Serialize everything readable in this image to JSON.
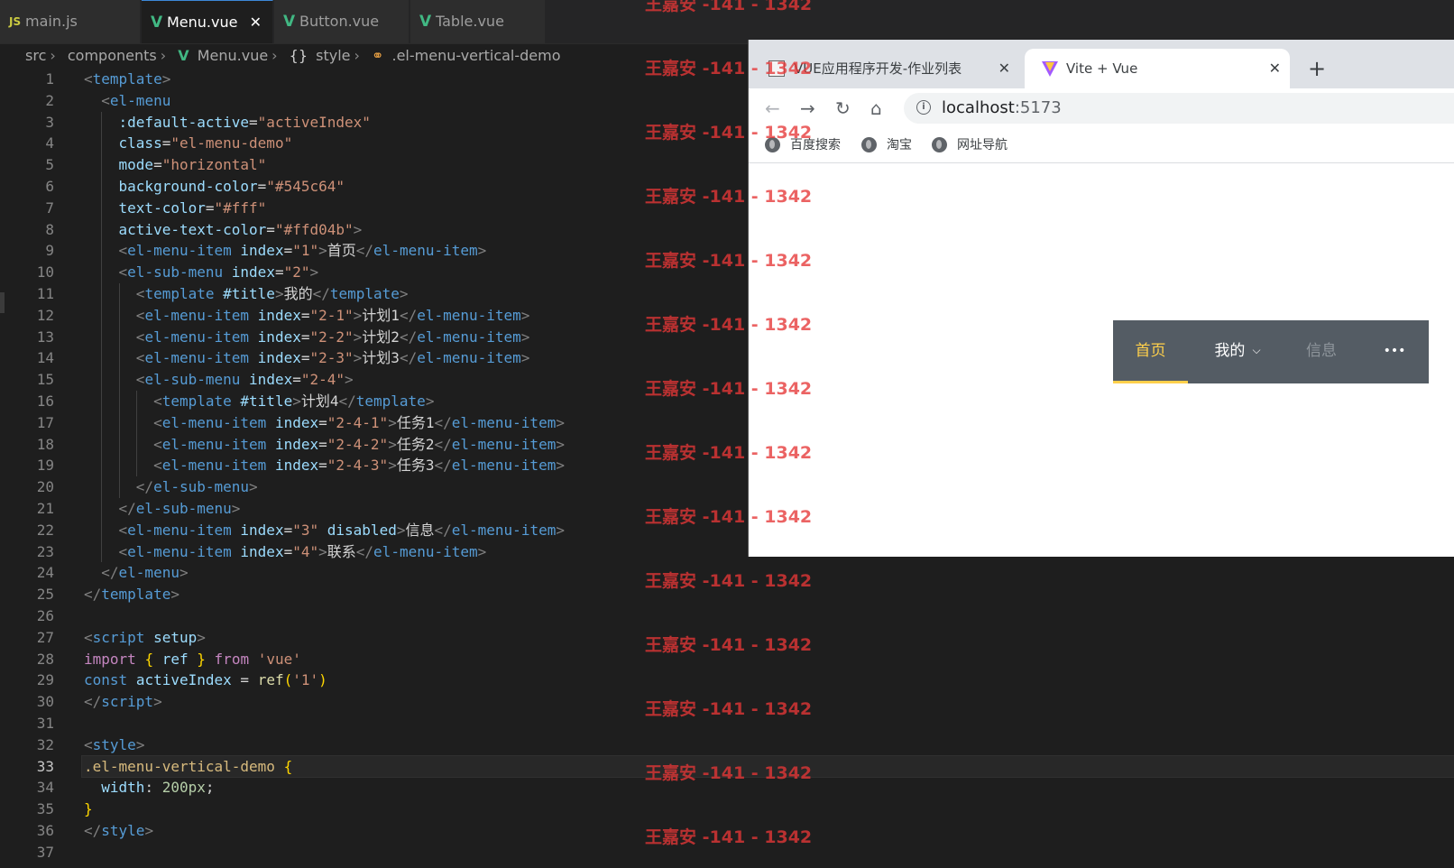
{
  "editor": {
    "tabs": [
      {
        "icon": "JS",
        "label": "main.js",
        "active": false
      },
      {
        "icon": "V",
        "label": "Menu.vue",
        "active": true,
        "close": "✕"
      },
      {
        "icon": "V",
        "label": "Button.vue",
        "active": false
      },
      {
        "icon": "V",
        "label": "Table.vue",
        "active": false
      }
    ],
    "breadcrumb": [
      "src",
      "components",
      "Menu.vue",
      "style",
      ".el-menu-vertical-demo"
    ],
    "current_line": 33,
    "line_numbers": [
      "1",
      "2",
      "3",
      "4",
      "5",
      "6",
      "7",
      "8",
      "9",
      "10",
      "11",
      "12",
      "13",
      "14",
      "15",
      "16",
      "17",
      "18",
      "19",
      "20",
      "21",
      "22",
      "23",
      "24",
      "25",
      "26",
      "27",
      "28",
      "29",
      "30",
      "31",
      "32",
      "33",
      "34",
      "35",
      "36",
      "37"
    ],
    "code": {
      "l3_val": "\"activeIndex\"",
      "l4_val": "\"el-menu-demo\"",
      "l5_val": "\"horizontal\"",
      "l6_val": "\"#545c64\"",
      "l7_val": "\"#fff\"",
      "l8_val": "\"#ffd04b\"",
      "l9_idx": "\"1\"",
      "l9_text": "首页",
      "l10_idx": "\"2\"",
      "l11_text": "我的",
      "l12_idx": "\"2-1\"",
      "l12_text": "计划1",
      "l13_idx": "\"2-2\"",
      "l13_text": "计划2",
      "l14_idx": "\"2-3\"",
      "l14_text": "计划3",
      "l15_idx": "\"2-4\"",
      "l16_text": "计划4",
      "l17_idx": "\"2-4-1\"",
      "l17_text": "任务1",
      "l18_idx": "\"2-4-2\"",
      "l18_text": "任务2",
      "l19_idx": "\"2-4-3\"",
      "l19_text": "任务3",
      "l22_idx": "\"3\"",
      "l22_text": "信息",
      "l23_idx": "\"4\"",
      "l23_text": "联系",
      "l28_str": "'vue'",
      "l29_str": "'1'",
      "l33_sel": ".el-menu-vertical-demo",
      "l34_prop": "width",
      "l34_val": "200px"
    }
  },
  "watermark": {
    "text": "王嘉安 -141 - 1342",
    "color": "#e63737"
  },
  "browser": {
    "tabs": [
      {
        "label": "VUE应用程序开发-作业列表",
        "close": "✕",
        "active": false
      },
      {
        "label": "Vite + Vue",
        "close": "✕",
        "active": true
      }
    ],
    "new_tab": "+",
    "url_host": "localhost",
    "url_port": ":5173",
    "bookmarks": [
      "百度搜索",
      "淘宝",
      "网址导航"
    ],
    "menu": {
      "background": "#545c64",
      "text_color": "#fff",
      "active_text_color": "#ffd04b",
      "items": [
        {
          "label": "首页",
          "state": "active"
        },
        {
          "label": "我的",
          "state": "submenu"
        },
        {
          "label": "信息",
          "state": "disabled"
        },
        {
          "label": "•••",
          "state": "more"
        }
      ]
    }
  }
}
